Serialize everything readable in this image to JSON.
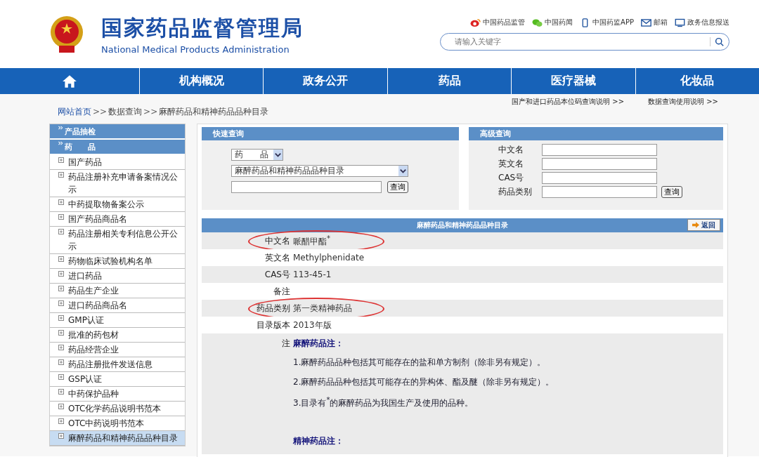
{
  "header": {
    "title_cn": "国家药品监督管理局",
    "title_en": "National Medical Products Administration",
    "links": [
      {
        "kind": "eye",
        "label": "中国药品监管"
      },
      {
        "kind": "chat",
        "label": "中国药闻"
      },
      {
        "kind": "phone",
        "label": "中国药监APP"
      },
      {
        "kind": "mail",
        "label": "邮箱"
      },
      {
        "kind": "monitor",
        "label": "政务信息报送"
      }
    ],
    "search": {
      "placeholder": "请输入关键字"
    }
  },
  "nav": [
    {
      "kind": "home"
    },
    {
      "kind": "text",
      "label": "机构概况"
    },
    {
      "kind": "text",
      "label": "政务公开"
    },
    {
      "kind": "text",
      "label": "药品"
    },
    {
      "kind": "text",
      "label": "医疗器械"
    },
    {
      "kind": "text",
      "label": "化妆品"
    }
  ],
  "breadcrumb": {
    "items": [
      "网站首页",
      "数据查询",
      "麻醉药品和精神药品品种目录"
    ],
    "separator": ">>"
  },
  "help_links": [
    "国产和进口药品本位码查询说明 >>",
    "数据查询使用说明 >>"
  ],
  "sidebar": {
    "sections": [
      "产品抽检",
      "药　　品"
    ],
    "items": [
      {
        "label": "国产药品",
        "selected": false
      },
      {
        "label": "药品注册补充申请备案情况公示",
        "selected": false
      },
      {
        "label": "中药提取物备案公示",
        "selected": false
      },
      {
        "label": "国产药品商品名",
        "selected": false
      },
      {
        "label": "药品注册相关专利信息公开公示",
        "selected": false
      },
      {
        "label": "药物临床试验机构名单",
        "selected": false
      },
      {
        "label": "进口药品",
        "selected": false
      },
      {
        "label": "药品生产企业",
        "selected": false
      },
      {
        "label": "进口药品商品名",
        "selected": false
      },
      {
        "label": "GMP认证",
        "selected": false
      },
      {
        "label": "批准的药包材",
        "selected": false
      },
      {
        "label": "药品经营企业",
        "selected": false
      },
      {
        "label": "药品注册批件发送信息",
        "selected": false
      },
      {
        "label": "GSP认证",
        "selected": false
      },
      {
        "label": "中药保护品种",
        "selected": false
      },
      {
        "label": "OTC化学药品说明书范本",
        "selected": false
      },
      {
        "label": "OTC中药说明书范本",
        "selected": false
      },
      {
        "label": "麻醉药品和精神药品品种目录",
        "selected": true
      }
    ]
  },
  "quick_search": {
    "title": "快速查询",
    "category": "药　　品",
    "catalog": "麻醉药品和精神药品品种目录",
    "button": "查询"
  },
  "advanced_search": {
    "title": "高级查询",
    "fields": [
      "中文名",
      "英文名",
      "CAS号",
      "药品类别"
    ],
    "button": "查询"
  },
  "result": {
    "title": "麻醉药品和精神药品品种目录",
    "back_button": "返回",
    "rows": [
      {
        "label": "中文名",
        "value": "哌醋甲酯$^{*}$",
        "circled": true
      },
      {
        "label": "英文名",
        "value": "Methylphenidate",
        "circled": false
      },
      {
        "label": "CAS号",
        "value": "113-45-1",
        "circled": false
      },
      {
        "label": "备注",
        "value": "",
        "circled": false
      },
      {
        "label": "药品类别",
        "value": "第一类精神药品",
        "circled": true
      },
      {
        "label": "目录版本",
        "value": "2013年版",
        "circled": false
      }
    ],
    "notes": {
      "label": "注",
      "sections": [
        {
          "heading": "麻醉药品注：",
          "lines": [
            "1.麻醉药品品种包括其可能存在的盐和单方制剂（除非另有规定）。",
            "2.麻醉药品品种包括其可能存在的异构体、酯及醚（除非另有规定）。",
            "3.目录有$^{*}$的麻醉药品为我国生产及使用的品种。"
          ]
        },
        {
          "heading": "精神药品注："
        }
      ]
    }
  }
}
